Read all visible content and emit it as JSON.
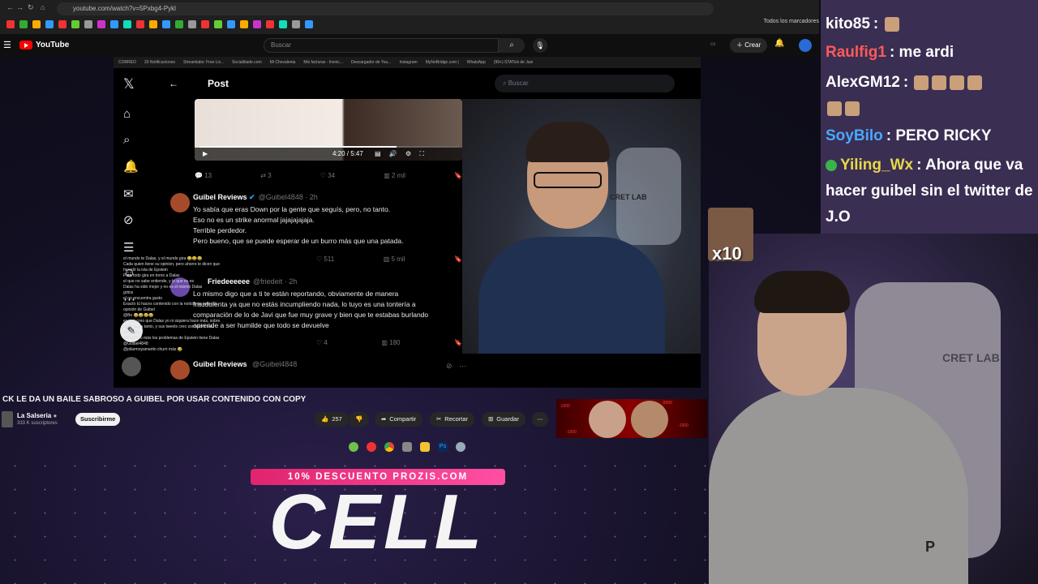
{
  "browser": {
    "url": "youtube.com/watch?v=5Pxbg4-Pykl",
    "bookmarks_label": "Todos los marcadores"
  },
  "youtube": {
    "logo": "YouTube",
    "search_placeholder": "Buscar",
    "create_label": "Crear",
    "video_title": "CK LE DA UN BAILE SABROSO A GUIBEL POR USAR CONTENIDO CON COPY",
    "channel_name": "La Salseria",
    "channel_subs": "333 K suscriptores",
    "subscribe": "Suscribirme",
    "likes": "257",
    "share": "Compartir",
    "clip": "Recortar",
    "save": "Guardar"
  },
  "inner_bookmarks": [
    "CORREO",
    "20 Notificaciones",
    "Streamlabs: Free Liv...",
    "Socialblade.com",
    "Mi Chevalenia",
    "Mis facturas - Invoic...",
    "Descargador de You...",
    "Instagram",
    "MyNoBridge.com |",
    "WhatsApp",
    "(99+) STATick de Javi"
  ],
  "twitter": {
    "post_title": "Post",
    "search_placeholder": "Buscar",
    "video_time": "4:20 / 5:47",
    "video_progress": 0.76,
    "stats1": {
      "replies": "13",
      "retweets": "3",
      "likes": "34",
      "views": "2 mil"
    },
    "tweet1": {
      "name": "Guibel Reviews",
      "handle": "@Guibel4848 · 2h",
      "lines": [
        "Yo sabía que eras Down por la gente que seguís, pero, no tanto.",
        "Eso no es un strike anormal jajajajajaja.",
        "Terrible perdedor.",
        "Pero bueno, que se puede esperar de un burro más que una patada."
      ],
      "likes": "511",
      "views": "5 mil"
    },
    "tweet2": {
      "name": "Friedeeeeee",
      "handle": "@friedeit · 2h",
      "lines": [
        "Lo mismo digo que a ti te están reportando, obviamente de manera",
        "fraudulenta ya que no estás incumpliendo nada, lo tuyo es una tontería a",
        "comparación de lo de Javi que fue muy grave y bien que te estabas burlando",
        "aprende a ser humilde que todo se devuelve"
      ],
      "likes": "4",
      "views": "180"
    },
    "tweet3": {
      "name": "Guibel Reviews",
      "handle": "@Guibel4848"
    }
  },
  "stream_overlay_chat": [
    "el mundo te Dalas, y el mundo gira 😂😂😂",
    "Cada quien tiene su opinion, pero ahorre le dicen que",
    "heredó la isla de Epstein",
    "Para todo gira en torno a Dalas",
    "el que no sabe entiende, y lo que es es",
    "Dalas ha sido mejor y no es el mismo Dalas",
    "gritos",
    "el no encuentra gusto",
    "Exacto tú haces contenido con la noticia no sobre lo",
    "opinión de Guibel",
    "@Bo 😂😂😂😂",
    "es que creo que Dalas yo ni siquiera hace más, sobre",
    "video cada tanto, y sus tweets creo son sobre sus",
    "proyectos",
    "Dalas tuvo más los problemas de Epstein tiene Dalas",
    "@Guibel4848",
    "@pilarmoyamartin churri más 😂"
  ],
  "facecam_chair_text": "CRET LAB",
  "chat": {
    "messages": [
      {
        "user": "kito85",
        "text": ":",
        "user_color": "#ffffff"
      },
      {
        "user": "Raulfig1",
        "text": ": me ardi",
        "user_color": "#ff5a5a"
      },
      {
        "user": "AlexGM12",
        "text": ":",
        "user_color": "#ffffff"
      },
      {
        "user": "SoyBilo",
        "text": ": PERO RICKY",
        "user_color": "#4aa8ff"
      },
      {
        "user": "Yiling_Wx",
        "text": ": Ahora que va hacer guibel sin el twitter de J.O",
        "user_color": "#e6d84a"
      }
    ],
    "emote_multiplier": "x10"
  },
  "promo": {
    "banner": "10% DESCUENTO PROZIS.COM",
    "code": "CELL"
  },
  "webcam_chair_text": "CRET LAB",
  "side_thumb_numbers": [
    "-1000",
    "-9999",
    "-1000",
    "-1000"
  ]
}
